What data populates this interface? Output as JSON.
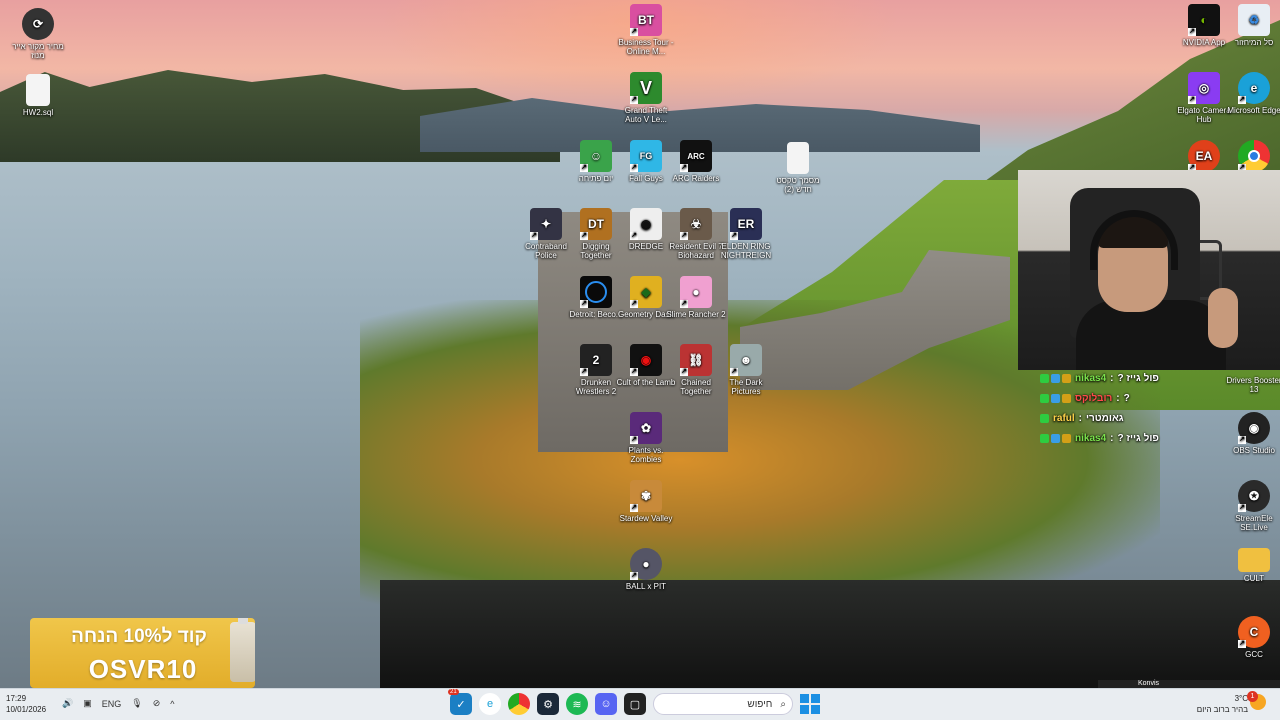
{
  "desktop": {
    "icons": [
      {
        "key": "recycle-left",
        "label": "מחיר מקור\nאייר מנוז",
        "color": "#333"
      },
      {
        "key": "hw2",
        "label": "HW2.sql",
        "color": "#f4f4f4"
      },
      {
        "key": "business-tour",
        "label": "Business Tour - Online M...",
        "color": "#d94fa0"
      },
      {
        "key": "gta",
        "label": "Grand Theft Auto V Le...",
        "color": "#2d8a2d"
      },
      {
        "key": "game-green",
        "label": "יום פתיחה",
        "color": "#3aa34a"
      },
      {
        "key": "fall-guys",
        "label": "Fall Guys",
        "color": "#2fb7e6"
      },
      {
        "key": "arc-raiders",
        "label": "ARC Raiders",
        "color": "#111"
      },
      {
        "key": "text-file",
        "label": "מסמך טקסט חדש (2)",
        "color": "#f4f4f4"
      },
      {
        "key": "contraband",
        "label": "Contraband Police",
        "color": "#334"
      },
      {
        "key": "digging",
        "label": "Digging Together",
        "color": "#b07020"
      },
      {
        "key": "dredge",
        "label": "DREDGE",
        "color": "#eee"
      },
      {
        "key": "resident-evil",
        "label": "Resident Evil 7 Biohazard",
        "color": "#6a5a4a"
      },
      {
        "key": "elden-ring",
        "label": "ELDEN RING NIGHTREIGN",
        "color": "#2a2f55"
      },
      {
        "key": "detroit",
        "label": "Detroit: Beco...",
        "color": "#0a0a0a"
      },
      {
        "key": "geometry-dash",
        "label": "Geometry Dash",
        "color": "#e0b020"
      },
      {
        "key": "slime-rancher",
        "label": "Slime Rancher 2",
        "color": "#f0a0d0"
      },
      {
        "key": "drunken-wrestlers",
        "label": "Drunken Wrestlers 2",
        "color": "#222"
      },
      {
        "key": "cult-of-the-lamb",
        "label": "Cult of the Lamb",
        "color": "#c11"
      },
      {
        "key": "chained-together",
        "label": "Chained Together",
        "color": "#b33"
      },
      {
        "key": "dark-pictures",
        "label": "The Dark Pictures",
        "color": "#9aa"
      },
      {
        "key": "plants-zombies",
        "label": "Plants vs. Zombies",
        "color": "#5a2a7a"
      },
      {
        "key": "stardew",
        "label": "Stardew Valley",
        "color": "#c88a3a"
      },
      {
        "key": "ball-pit",
        "label": "BALL x PIT",
        "color": "#556"
      },
      {
        "key": "nvidia",
        "label": "NVIDIA App",
        "color": "#111"
      },
      {
        "key": "recycle-bin",
        "label": "סל המיחזור",
        "color": "#e8eef4"
      },
      {
        "key": "elgato",
        "label": "Elgato Camera Hub",
        "color": "#8a3cf2"
      },
      {
        "key": "edge",
        "label": "Microsoft Edge",
        "color": "#1aa1d8"
      },
      {
        "key": "ea",
        "label": "",
        "color": "#e0401a"
      },
      {
        "key": "chrome",
        "label": "",
        "color": "#2c9a3c"
      },
      {
        "key": "drivers-booster",
        "label": "Drivers Booster 13",
        "color": "#c02a2a"
      },
      {
        "key": "obs",
        "label": "OBS Studio",
        "color": "#222"
      },
      {
        "key": "streamelements",
        "label": "StreamEle SE.Live",
        "color": "#2a2a2a"
      },
      {
        "key": "cult-folder",
        "label": "CULT",
        "color": "#f0c040"
      },
      {
        "key": "gcc",
        "label": "GCC",
        "color": "#f06020"
      }
    ]
  },
  "chat": {
    "messages": [
      {
        "user": "nikas4",
        "msg": "פול גייז ?"
      },
      {
        "user": "רובלוקס",
        "msg": "?"
      },
      {
        "user": "raful",
        "msg": "גאומטרי"
      },
      {
        "user": "nikas4",
        "msg": "פול גייז ?"
      }
    ]
  },
  "ad": {
    "line1": "קוד ל10% הנחה",
    "line2": "OSVR10"
  },
  "stream_mini": {
    "name": "Konvis"
  },
  "taskbar": {
    "time": "17:29",
    "date": "10/01/2026",
    "language": "ENG",
    "search_placeholder": "חיפוש",
    "weather_temp": "3°C",
    "weather_desc": "בהיר ברוב היום",
    "notif_count": "1",
    "steam_badge": "21"
  }
}
